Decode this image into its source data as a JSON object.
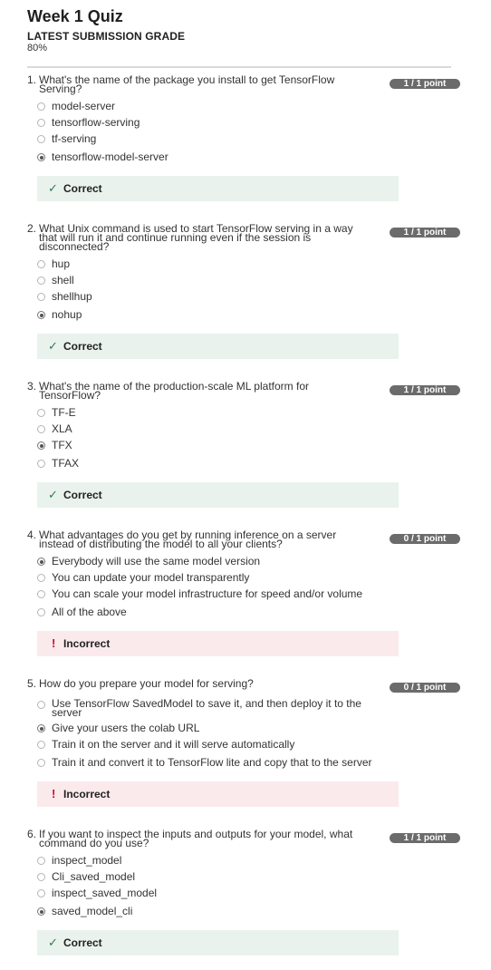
{
  "header": {
    "title": "Week 1 Quiz",
    "grade_label": "LATEST SUBMISSION GRADE",
    "grade_value": "80%"
  },
  "colors": {
    "badge_bg": "#6b6b6b",
    "correct_bg": "#eaf2ee",
    "incorrect_bg": "#fbeaec",
    "check": "#2f7a4f",
    "error": "#c4102b"
  },
  "questions": [
    {
      "number": "1.",
      "text": "What's the name of the package you install to get TensorFlow Serving?",
      "points": "1 / 1 point",
      "options": [
        {
          "label": "model-server",
          "selected": false
        },
        {
          "label": "tensorflow-serving",
          "selected": false
        },
        {
          "label": "tf-serving",
          "selected": false
        },
        {
          "label": "tensorflow-model-server",
          "selected": true
        }
      ],
      "feedback": {
        "status": "correct",
        "icon": "check-icon",
        "glyph": "✓",
        "label": "Correct"
      }
    },
    {
      "number": "2.",
      "text": "What Unix command is used to start TensorFlow serving in a way that will run it and continue running even if the session is disconnected?",
      "points": "1 / 1 point",
      "options": [
        {
          "label": "hup",
          "selected": false
        },
        {
          "label": "shell",
          "selected": false
        },
        {
          "label": "shellhup",
          "selected": false
        },
        {
          "label": "nohup",
          "selected": true
        }
      ],
      "feedback": {
        "status": "correct",
        "icon": "check-icon",
        "glyph": "✓",
        "label": "Correct"
      }
    },
    {
      "number": "3.",
      "text": "What's the name of the production-scale ML platform for TensorFlow?",
      "points": "1 / 1 point",
      "options": [
        {
          "label": "TF-E",
          "selected": false
        },
        {
          "label": "XLA",
          "selected": false
        },
        {
          "label": "TFX",
          "selected": true
        },
        {
          "label": "TFAX",
          "selected": false
        }
      ],
      "feedback": {
        "status": "correct",
        "icon": "check-icon",
        "glyph": "✓",
        "label": "Correct"
      }
    },
    {
      "number": "4.",
      "text": "What advantages do you get by running inference on a server instead of distributing the model to all your clients?",
      "points": "0 / 1 point",
      "options": [
        {
          "label": "Everybody will use the same model version",
          "selected": true
        },
        {
          "label": "You can update your model transparently",
          "selected": false
        },
        {
          "label": "You can scale your model infrastructure for speed and/or volume",
          "selected": false
        },
        {
          "label": "All of the above",
          "selected": false
        }
      ],
      "feedback": {
        "status": "incorrect",
        "icon": "exclamation-icon",
        "glyph": "!",
        "label": "Incorrect"
      }
    },
    {
      "number": "5.",
      "text": "How do you prepare your model for serving?",
      "points": "0 / 1 point",
      "options": [
        {
          "label": "Use TensorFlow SavedModel to save it, and then deploy it to the server",
          "selected": false
        },
        {
          "label": "Give your users the colab URL",
          "selected": true
        },
        {
          "label": "Train it on the server and it will serve automatically",
          "selected": false
        },
        {
          "label": "Train it and convert it to TensorFlow lite and copy that to the server",
          "selected": false
        }
      ],
      "feedback": {
        "status": "incorrect",
        "icon": "exclamation-icon",
        "glyph": "!",
        "label": "Incorrect"
      }
    },
    {
      "number": "6.",
      "text": "If you want to inspect the inputs and outputs for your model, what command do you use?",
      "points": "1 / 1 point",
      "options": [
        {
          "label": "inspect_model",
          "selected": false
        },
        {
          "label": "Cli_saved_model",
          "selected": false
        },
        {
          "label": "inspect_saved_model",
          "selected": false
        },
        {
          "label": "saved_model_cli",
          "selected": true
        }
      ],
      "feedback": {
        "status": "correct",
        "icon": "check-icon",
        "glyph": "✓",
        "label": "Correct"
      }
    }
  ]
}
